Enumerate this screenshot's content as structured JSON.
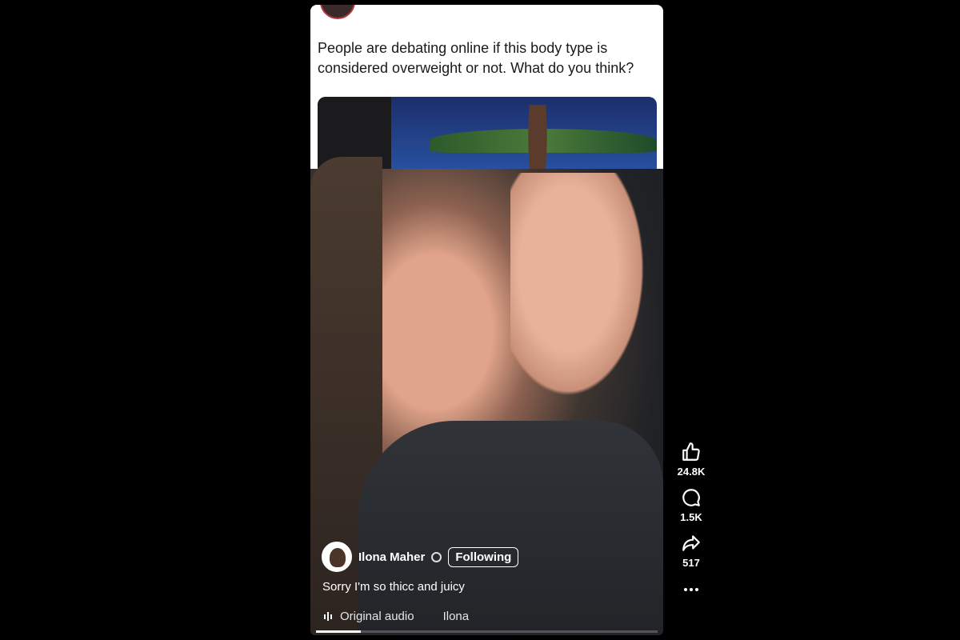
{
  "post": {
    "caption": "People are debating online if this body type is considered overweight or not. What do you think?"
  },
  "reel": {
    "username": "Ilona Maher",
    "follow_label": "Following",
    "caption": "Sorry I'm so thicc and juicy",
    "audio_label": "Original audio",
    "audio_author": "Ilona",
    "progress": 0.13
  },
  "actions": {
    "likes": "24.8K",
    "comments": "1.5K",
    "shares": "517"
  },
  "icons": [
    "thumbs-up-icon",
    "comment-icon",
    "share-icon",
    "more-icon",
    "globe-icon",
    "audio-icon"
  ],
  "colors": {
    "background": "#000000",
    "card": "#ffffff",
    "text_light": "#ffffff"
  }
}
